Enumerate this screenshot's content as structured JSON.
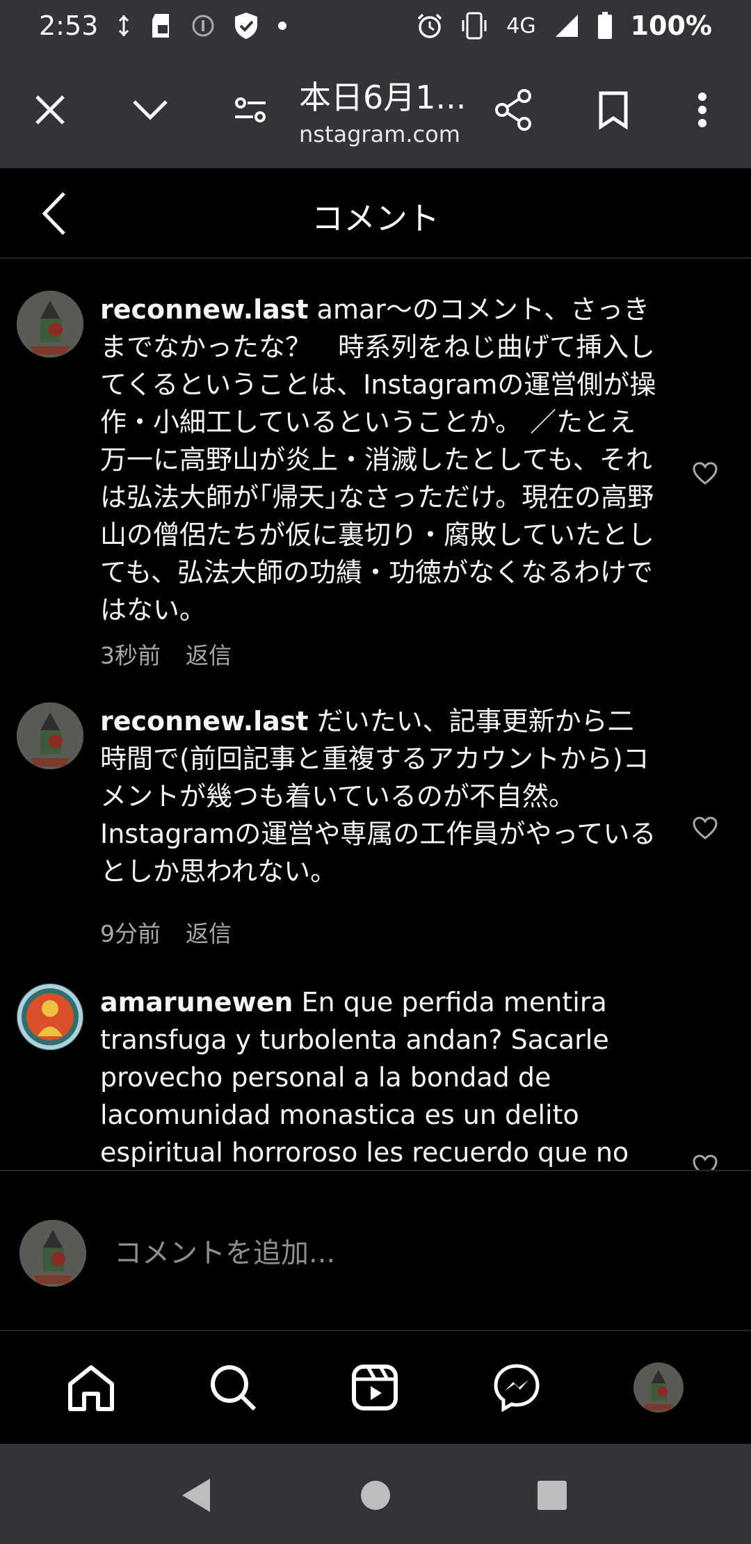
{
  "status_bar": {
    "time": "2:53",
    "network": "4G",
    "battery": "100%"
  },
  "browser": {
    "title": "本日6月1...",
    "url": "nstagram.com"
  },
  "header": {
    "title": "コメント"
  },
  "comments": [
    {
      "username": "reconnew.last",
      "text": " amar〜のコメント、さっきまでなかったな？　時系列をねじ曲げて挿入してくるということは、Instagramの運営側が操作・小細工しているということか。 ／たとえ万一に高野山が炎上・消滅したとしても、それは弘法大師が｢帰天｣なさっただけ。現在の高野山の僧侶たちが仮に裏切り・腐敗していたとしても、弘法大師の功績・功徳がなくなるわけではない。",
      "time": "3秒前",
      "reply": "返信"
    },
    {
      "username": "reconnew.last",
      "text": " だいたい、記事更新から二時間で(前回記事と重複するアカウントから)コメントが幾つも着いているのが不自然。Instagramの運営や専属の工作員がやっているとしか思われない。",
      "time": "9分前",
      "reply": "返信"
    },
    {
      "username": "amarunewen",
      "text": " En que perfida mentira transfuga y turbolenta andan? Sacarle provecho personal a la bondad de lacomunidad monastica es un delito espiritual horroroso les recuerdo que no se",
      "time": "",
      "reply": ""
    }
  ],
  "composer": {
    "placeholder": "コメントを追加..."
  },
  "colors": {
    "background": "#000000",
    "chrome": "#333437",
    "secondary_text": "#a8a8a8",
    "divider": "#262626"
  },
  "icons": {
    "close": "close-icon",
    "collapse": "chevron-down-icon",
    "site_settings": "tune-icon",
    "share": "share-icon",
    "bookmark": "bookmark-icon",
    "menu": "more-vertical-icon",
    "back": "chevron-left-icon",
    "like": "heart-icon",
    "home": "home-icon",
    "search": "search-icon",
    "reels": "reels-icon",
    "messenger": "messenger-icon"
  }
}
